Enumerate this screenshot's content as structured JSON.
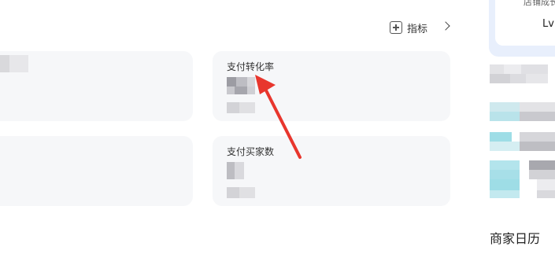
{
  "toolbar": {
    "add_metric_label": "指标"
  },
  "metrics": [
    {
      "name": "支付转化率"
    },
    {
      "name": "支付买家数"
    }
  ],
  "right_panel": {
    "top_text_partial": "店铺成长",
    "level_partial": "Lv",
    "calendar_title": "商家日历"
  },
  "colors": {
    "card_bg": "#f6f7f9",
    "arrow": "#e8362d",
    "panel_accent_bg": "#e8effc",
    "teal_blur": "#9edde6"
  },
  "icons": {
    "add": "plus-square-icon",
    "chevron": "chevron-right-icon",
    "annotation": "red-arrow-annotation"
  }
}
